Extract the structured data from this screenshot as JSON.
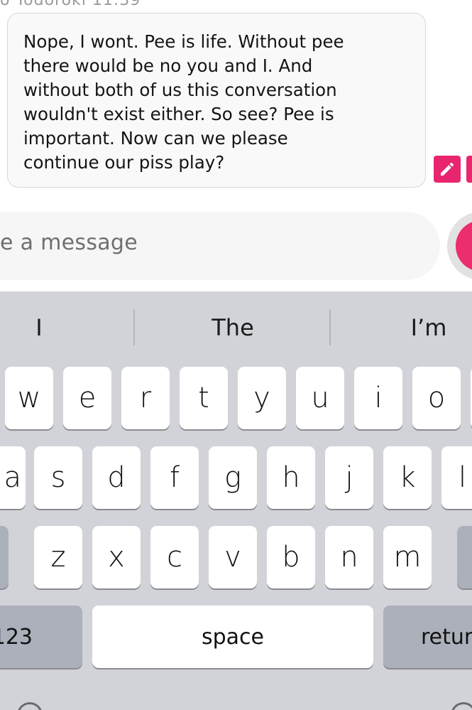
{
  "chat": {
    "sender_line": "o Todoroki     11:39",
    "message": "Nope, I wont. Pee is life. Without pee\nthere would be no you and I. And\nwithout both of us this conversation\nwouldn't exist either. So see? Pee is\nimportant. Now can we please\ncontinue our piss play?",
    "icons": {
      "edit": "pencil-icon",
      "secondary": "action-icon"
    }
  },
  "composer": {
    "placeholder": "e a message",
    "send_icon": "send-icon",
    "accent": "#ec2d6e"
  },
  "keyboard": {
    "suggestions": [
      "I",
      "The",
      "I’m"
    ],
    "row1": [
      "w",
      "e",
      "r",
      "t",
      "y",
      "u",
      "i",
      "o"
    ],
    "row2": [
      "a",
      "s",
      "d",
      "f",
      "g",
      "h",
      "j",
      "k",
      "l"
    ],
    "row3": [
      "z",
      "x",
      "c",
      "v",
      "b",
      "n",
      "m"
    ],
    "numbers_key": "123",
    "space_key": "space",
    "return_key": "retur"
  }
}
